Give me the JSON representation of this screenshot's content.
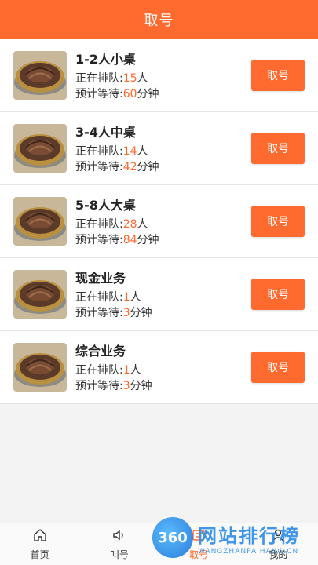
{
  "header": {
    "title": "取号"
  },
  "labels": {
    "queue_prefix": "正在排队:",
    "queue_unit": "人",
    "wait_prefix": "预计等待:",
    "wait_unit": "分钟",
    "button": "取号"
  },
  "items": [
    {
      "name": "1-2人小桌",
      "queue": "15",
      "wait": "60"
    },
    {
      "name": "3-4人中桌",
      "queue": "14",
      "wait": "42"
    },
    {
      "name": "5-8人大桌",
      "queue": "28",
      "wait": "84"
    },
    {
      "name": "现金业务",
      "queue": "1",
      "wait": "3"
    },
    {
      "name": "综合业务",
      "queue": "1",
      "wait": "3"
    }
  ],
  "tabbar": {
    "tabs": [
      {
        "label": "首页",
        "icon": "home-icon"
      },
      {
        "label": "叫号",
        "icon": "speaker-icon"
      },
      {
        "label": "取号",
        "icon": "ticket-icon",
        "active": true
      },
      {
        "label": "我的",
        "icon": "user-icon"
      }
    ]
  },
  "watermark": {
    "logo": "360",
    "title": "网站排行榜",
    "sub": "WANGZHANPAIHANG.CN"
  },
  "colors": {
    "accent": "#ff6a2f"
  }
}
